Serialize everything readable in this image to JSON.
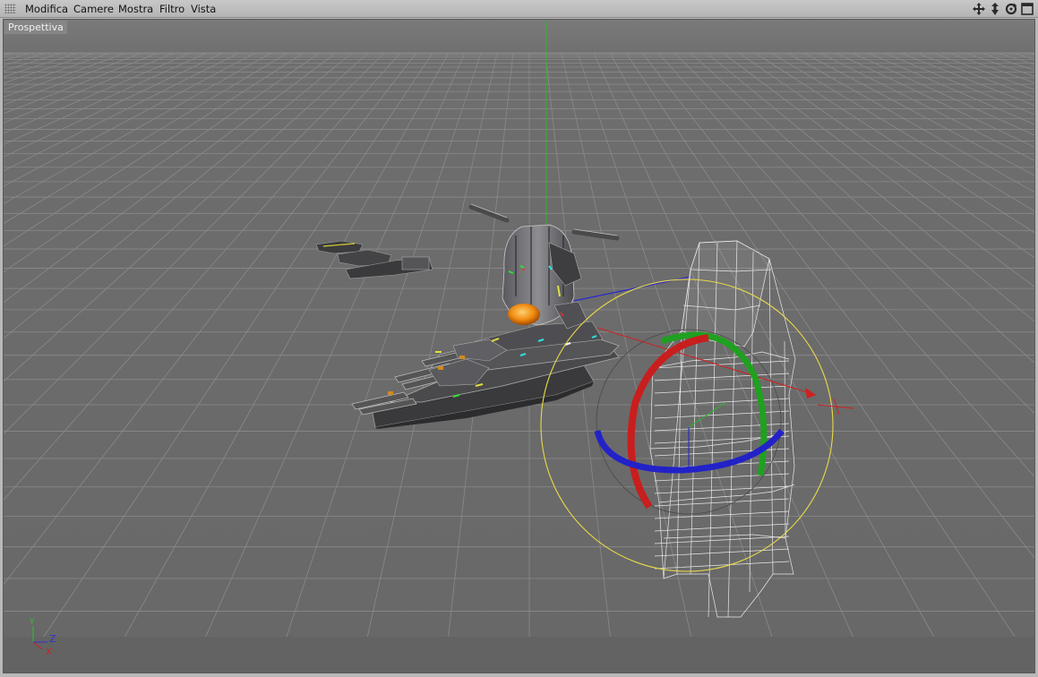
{
  "menubar": {
    "items": [
      "Modifica",
      "Camere",
      "Mostra",
      "Filtro",
      "Vista"
    ]
  },
  "nav_icons": [
    "move-view-icon",
    "dolly-view-icon",
    "rotate-view-icon",
    "maximize-view-icon"
  ],
  "viewport": {
    "label": "Prospettiva"
  },
  "axis_indicator": {
    "y": "Y",
    "z": "Z",
    "x": "X"
  },
  "colors": {
    "x_axis": "#d02020",
    "y_axis": "#20a020",
    "z_axis": "#2020c8",
    "selection_circle": "#e8d84a",
    "grid_line": "#8a8a8a"
  }
}
